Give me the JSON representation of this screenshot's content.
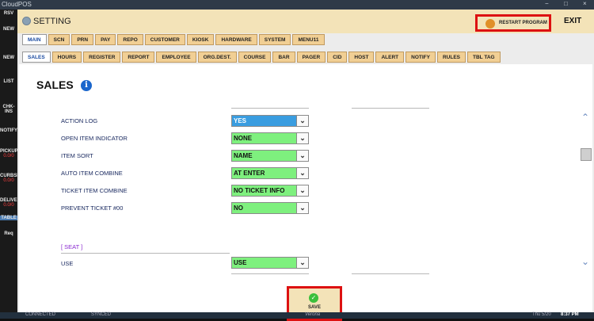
{
  "window": {
    "title": "CloudPOS",
    "controls": [
      "−",
      "□",
      "×"
    ]
  },
  "left_nav": [
    {
      "label": "RSV",
      "sub": ""
    },
    {
      "label": "NEW",
      "sub": ""
    },
    {
      "label": "NEW",
      "sub": ""
    },
    {
      "label": "LIST",
      "sub": ""
    },
    {
      "label": "CHK-INS",
      "sub": ""
    },
    {
      "label": "NOTIFY",
      "sub": ""
    },
    {
      "label": "PICKUP",
      "sub": "0.0/0"
    },
    {
      "label": "CURBSIDE",
      "sub": "0.0/0"
    },
    {
      "label": "DELIVERY",
      "sub": "0.0/0"
    },
    {
      "label": "TABLE",
      "sub": ""
    },
    {
      "label": "Req",
      "sub": ""
    }
  ],
  "header": {
    "title": "SETTING",
    "restart_label": "RESTART PROGRAM",
    "exit_label": "EXIT"
  },
  "main_tabs": [
    "MAIN",
    "SCN",
    "PRN",
    "PAY",
    "REPO",
    "CUSTOMER",
    "KIOSK",
    "HARDWARE",
    "SYSTEM",
    "MENU11"
  ],
  "sub_tabs": [
    "SALES",
    "HOURS",
    "REGISTER",
    "REPORT",
    "EMPLOYEE",
    "ORG.DEST.",
    "COURSE",
    "BAR",
    "PAGER",
    "CID",
    "HOST",
    "ALERT",
    "NOTIFY",
    "RULES",
    "TBL TAG"
  ],
  "page": {
    "title": "SALES",
    "info_glyph": "i"
  },
  "settings": [
    {
      "label": "ACTION LOG",
      "value": "YES"
    },
    {
      "label": "OPEN ITEM INDICATOR",
      "value": "NONE"
    },
    {
      "label": "ITEM SORT",
      "value": "NAME"
    },
    {
      "label": "AUTO ITEM COMBINE",
      "value": "AT ENTER"
    },
    {
      "label": "TICKET ITEM COMBINE",
      "value": "NO TICKET INFO"
    },
    {
      "label": "PREVENT TICKET #00",
      "value": "NO"
    }
  ],
  "seat_section": {
    "title": "[ SEAT ]",
    "label": "USE",
    "value": "USE"
  },
  "save_label": "SAVE",
  "status": {
    "connected": "CONNECTED",
    "synced": "SYNCED",
    "brand": "Verona",
    "date": "Thu 5/20",
    "time": "8:37 PM"
  }
}
